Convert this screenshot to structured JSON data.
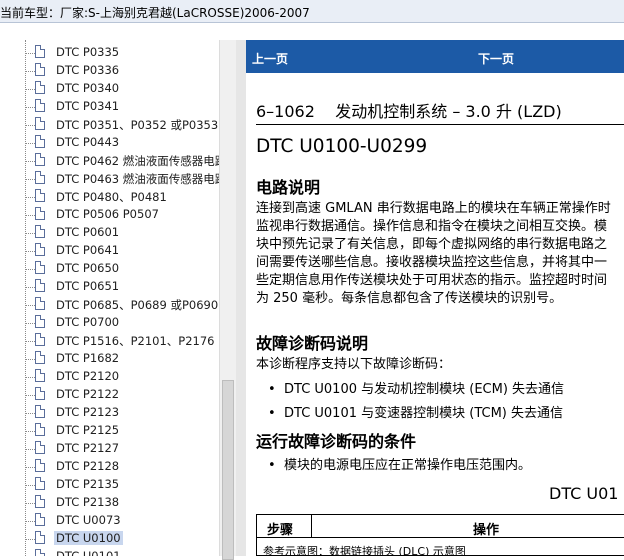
{
  "window": {
    "title": "当前车型：厂家:S-上海别克君越(LaCROSSE)2006-2007"
  },
  "tree": {
    "items": [
      {
        "label": "DTC P0335"
      },
      {
        "label": "DTC P0336"
      },
      {
        "label": "DTC P0340"
      },
      {
        "label": "DTC P0341"
      },
      {
        "label": "DTC P0351、P0352 或P0353"
      },
      {
        "label": "DTC P0443"
      },
      {
        "label": "DTC P0462 燃油液面传感器电路"
      },
      {
        "label": "DTC P0463 燃油液面传感器电路"
      },
      {
        "label": "DTC P0480、P0481"
      },
      {
        "label": "DTC P0506 P0507"
      },
      {
        "label": "DTC P0601"
      },
      {
        "label": "DTC P0641"
      },
      {
        "label": "DTC P0650"
      },
      {
        "label": "DTC P0651"
      },
      {
        "label": "DTC P0685、P0689 或P0690"
      },
      {
        "label": "DTC P0700"
      },
      {
        "label": "DTC P1516、P2101、P2176"
      },
      {
        "label": "DTC P1682"
      },
      {
        "label": "DTC P2120"
      },
      {
        "label": "DTC P2122"
      },
      {
        "label": "DTC P2123"
      },
      {
        "label": "DTC P2125"
      },
      {
        "label": "DTC P2127"
      },
      {
        "label": "DTC P2128"
      },
      {
        "label": "DTC P2135"
      },
      {
        "label": "DTC P2138"
      },
      {
        "label": "DTC U0073"
      },
      {
        "label": "DTC U0100",
        "selected": true
      },
      {
        "label": "DTC U0101"
      }
    ]
  },
  "nav": {
    "prev_label": "上一页",
    "next_label": "下一页"
  },
  "document": {
    "section_title": "6–1062    发动机控制系统 – 3.0 升 (LZD)",
    "dtc_heading": "DTC U0100-U0299",
    "circuit_heading": "电路说明",
    "circuit_text": "连接到高速 GMLAN 串行数据电路上的模块在车辆正常操作时监视串行数据通信。操作信息和指令在模块之间相互交换。模块中预先记录了有关信息，即每个虚拟网络的串行数据电路之间需要传送哪些信息。接收器模块监控这些信息，并将其中一些定期信息用作传送模块处于可用状态的指示。监控超时时间为 250 毫秒。每条信息都包含了传送模块的识别号。",
    "dtc_desc_heading": "故障诊断码说明",
    "dtc_desc_intro": "本诊断程序支持以下故障诊断码：",
    "dtc_bullets": [
      "DTC U0100 与发动机控制模块 (ECM) 失去通信",
      "DTC U0101 与变速器控制模块 (TCM) 失去通信"
    ],
    "run_heading": "运行故障诊断码的条件",
    "run_bullets": [
      "模块的电源电压应在正常操作电压范围内。"
    ],
    "table_title": "DTC U01",
    "table": {
      "col_step": "步骤",
      "col_action": "操作",
      "first_row": "参考示意图：数据链接插头 (DLC) 示意图"
    }
  }
}
